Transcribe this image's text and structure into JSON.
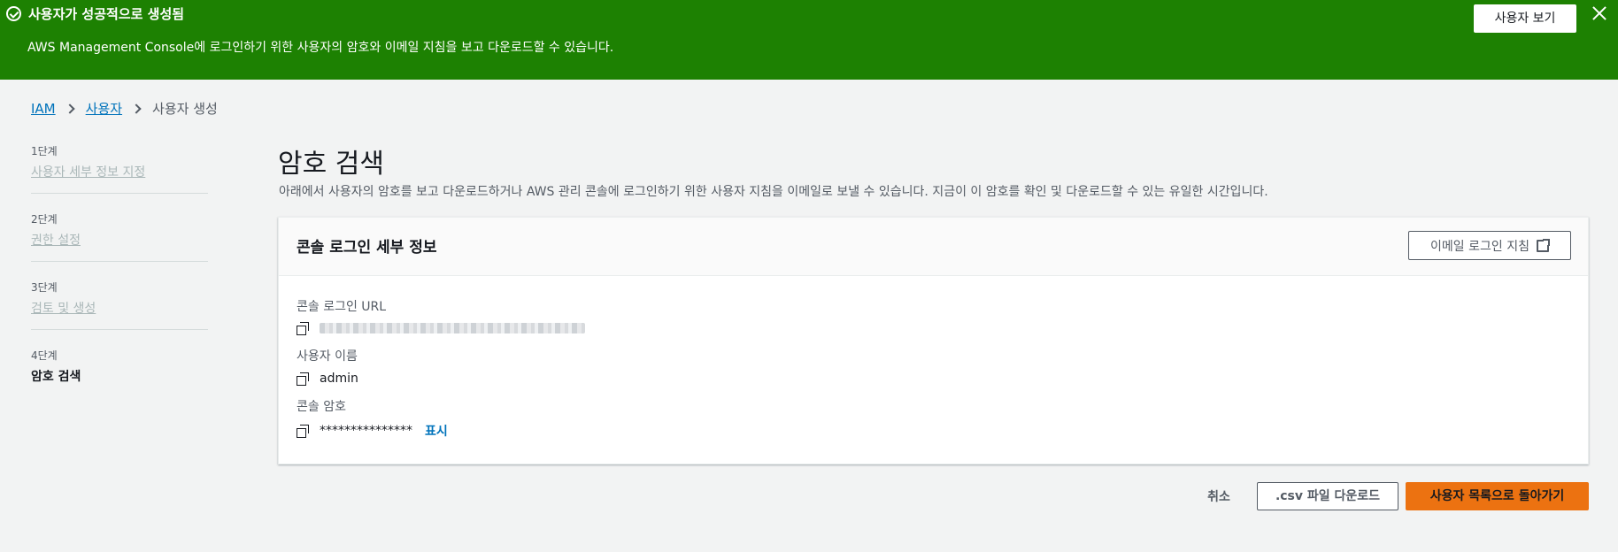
{
  "flash": {
    "title": "사용자가 성공적으로 생성됨",
    "message": "AWS Management Console에 로그인하기 위한 사용자의 암호와 이메일 지침을 보고 다운로드할 수 있습니다.",
    "view_user_label": "사용자 보기",
    "color": "#1d8102"
  },
  "breadcrumb": {
    "items": [
      "IAM",
      "사용자",
      "사용자 생성"
    ]
  },
  "steps": [
    {
      "num": "1단계",
      "label": "사용자 세부 정보 지정"
    },
    {
      "num": "2단계",
      "label": "권한 설정"
    },
    {
      "num": "3단계",
      "label": "검토 및 생성"
    },
    {
      "num": "4단계",
      "label": "암호 검색"
    }
  ],
  "main": {
    "title": "암호 검색",
    "description": "아래에서 사용자의 암호를 보고 다운로드하거나 AWS 관리 콘솔에 로그인하기 위한 사용자 지침을 이메일로 보낼 수 있습니다. 지금이 이 암호를 확인 및 다운로드할 수 있는 유일한 시간입니다."
  },
  "panel": {
    "title": "콘솔 로그인 세부 정보",
    "email_button_label": "이메일 로그인 지침",
    "fields": {
      "url_label": "콘솔 로그인 URL",
      "username_label": "사용자 이름",
      "username_value": "admin",
      "password_label": "콘솔 암호",
      "password_value": "***************",
      "show_label": "표시"
    }
  },
  "actions": {
    "cancel_label": "취소",
    "csv_label": ".csv 파일 다운로드",
    "back_label": "사용자 목록으로 돌아가기",
    "primary_color": "#ec7211"
  }
}
